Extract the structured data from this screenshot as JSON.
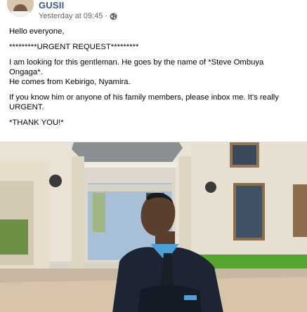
{
  "post": {
    "group_name": "GUSII",
    "timestamp": "Yesterday at 09:45",
    "separator": "·",
    "privacy_icon": "globe-icon",
    "paragraphs": {
      "p1": "Hello everyone,",
      "p2": "*********URGENT REQUEST*********",
      "p3a": "I am looking for this gentleman. He goes by the name of *Steve Ombuya Ongaga*.",
      "p3b": "He comes from Kebirigo, Nyamira.",
      "p4": "If you know him or anyone of his family members, please inbox me. It's really URGENT.",
      "p5": "*THANK YOU!*"
    }
  },
  "colors": {
    "group_link": "#385898",
    "meta_text": "#65676b",
    "body_text": "#050505"
  }
}
